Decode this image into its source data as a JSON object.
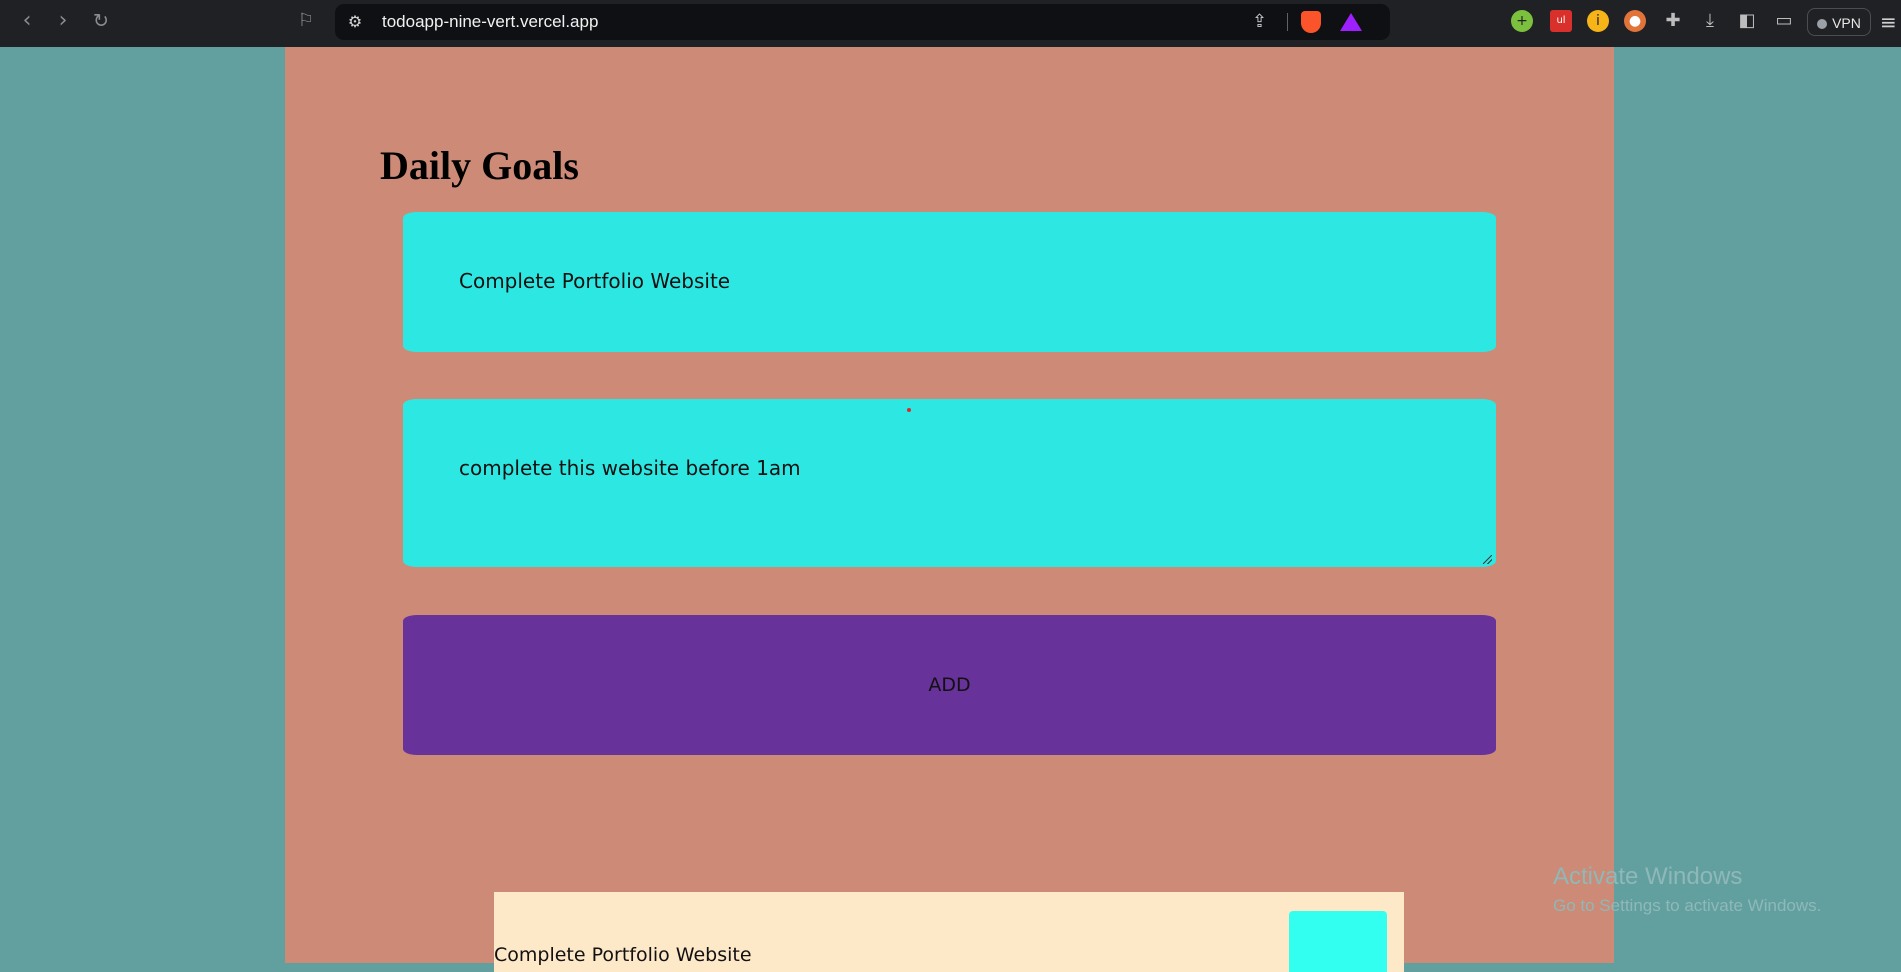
{
  "browser": {
    "url": "todoapp-nine-vert.vercel.app",
    "vpn_label": "VPN",
    "icons": [
      "back-icon",
      "forward-icon",
      "reload-icon",
      "bookmark-icon",
      "site-settings-icon",
      "share-icon",
      "brave-shields-icon",
      "brave-rewards-icon",
      "extensions-icon",
      "downloads-icon",
      "sidebar-icon",
      "wallet-icon",
      "menu-icon"
    ]
  },
  "app": {
    "title": "Daily Goals",
    "goal_input_value": "Complete Portfolio Website",
    "goal_description_value": "complete this website before 1am",
    "add_button_label": "ADD",
    "goals": [
      {
        "title": "Complete Portfolio Website"
      }
    ],
    "colors": {
      "page_bg": "#62a0a0",
      "app_bg": "#cd8a76",
      "input_bg": "#2de8e2",
      "add_button_bg": "#67329a",
      "card_bg": "#fde8c8",
      "card_button_bg": "#33fff0"
    }
  },
  "os": {
    "watermark_title": "Activate Windows",
    "watermark_subtitle": "Go to Settings to activate Windows."
  }
}
